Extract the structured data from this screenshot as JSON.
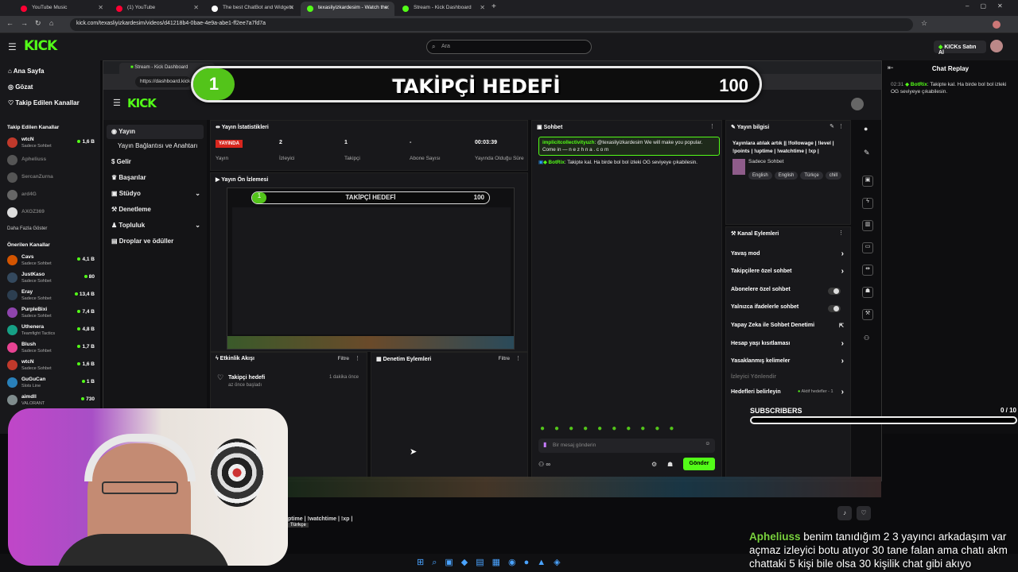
{
  "browser": {
    "tabs": [
      {
        "label": "YouTube Music",
        "color": "#ff0033"
      },
      {
        "label": "(1) YouTube",
        "color": "#ff0033"
      },
      {
        "label": "The best ChatBot and Widgets",
        "color": "#ffffff"
      },
      {
        "label": "texasliyizkardesim - Watch the",
        "color": "#53fc18"
      },
      {
        "label": "Stream - Kick Dashboard",
        "color": "#53fc18"
      }
    ],
    "url": "kick.com/texasliyizkardesim/videos/d41218b4-0bae-4e9a-abe1-ff2ee7a7fd7a"
  },
  "header": {
    "logo": "KICK",
    "search_placeholder": "Ara",
    "buy_kicks": "KICKs Satın Al"
  },
  "sidebar": {
    "nav": [
      "Ana Sayfa",
      "Gözat",
      "Takip Edilen Kanallar"
    ],
    "followed_title": "Takip Edilen Kanallar",
    "followed": [
      {
        "name": "wtcN",
        "category": "Sadece Sohbet",
        "viewers": "1,6 B",
        "online": true,
        "color": "#c0392b"
      },
      {
        "name": "Apheliuss",
        "category": "",
        "viewers": "",
        "online": false,
        "color": "#555"
      },
      {
        "name": "SercanZurna",
        "category": "",
        "viewers": "",
        "online": false,
        "color": "#555"
      },
      {
        "name": "ard4G",
        "category": "",
        "viewers": "",
        "online": false,
        "color": "#666"
      },
      {
        "name": "AXOZ369",
        "category": "",
        "viewers": "",
        "online": false,
        "color": "#ddd"
      }
    ],
    "show_more": "Daha Fazla Göster",
    "recommended_title": "Önerilen Kanallar",
    "recommended": [
      {
        "name": "Cavs",
        "category": "Sadece Sohbet",
        "viewers": "4,1 B",
        "color": "#d35400"
      },
      {
        "name": "JustKaso",
        "category": "Sadece Sohbet",
        "viewers": "80",
        "color": "#34495e"
      },
      {
        "name": "Eray",
        "category": "Sadece Sohbet",
        "viewers": "13,4 B",
        "color": "#2c3e50"
      },
      {
        "name": "PurpleBixi",
        "category": "Sadece Sohbet",
        "viewers": "7,4 B",
        "color": "#8e44ad"
      },
      {
        "name": "Uthenera",
        "category": "Teamfight Tactics",
        "viewers": "4,8 B",
        "color": "#16a085"
      },
      {
        "name": "Blush",
        "category": "Sadece Sohbet",
        "viewers": "1,7 B",
        "color": "#e84393"
      },
      {
        "name": "wtcN",
        "category": "Sadece Sohbet",
        "viewers": "1,6 B",
        "color": "#c0392b"
      },
      {
        "name": "GuGuCan",
        "category": "Slots Line",
        "viewers": "1 B",
        "color": "#2980b9"
      },
      {
        "name": "aimdll",
        "category": "VALORANT",
        "viewers": "730",
        "color": "#7f8c8d"
      }
    ]
  },
  "chat_replay": {
    "title": "Chat Replay",
    "messages": [
      {
        "time": "02:31",
        "user": "BotRix",
        "text": ": Takipte kal. Ha birde bol bol izleki OG seviyeye çıkabilesin."
      }
    ]
  },
  "inner": {
    "tab_label": "Stream - Kick Dashboard",
    "url": "https://dashboard.kick.com",
    "side_nav": [
      "Yayın",
      "Yayın Bağlantısı ve Anahtarı",
      "Gelir",
      "Başarılar",
      "Stüdyo",
      "Denetleme",
      "Topluluk",
      "Droplar ve ödüller"
    ],
    "stats_title": "Yayın İstatistikleri",
    "stats": [
      {
        "value": "YAYINDA",
        "label": "Yayın"
      },
      {
        "value": "2",
        "label": "İzleyici"
      },
      {
        "value": "1",
        "label": "Takipçi"
      },
      {
        "value": "-",
        "label": "Abone Sayısı"
      },
      {
        "value": "00:03:39",
        "label": "Yayında Olduğu Süre"
      }
    ],
    "preview_title": "Yayın Ön İzlemesi",
    "activity_title": "Etkinlik Akışı",
    "filter_label": "Filtre",
    "activity": {
      "title": "Takipçi hedefi",
      "subtitle": "az önce başladı",
      "time": "1 dakika önce"
    },
    "moderation_title": "Denetim Eylemleri",
    "chat_title": "Sohbet",
    "chat_messages": [
      {
        "user": "implicitcollectivityuzh",
        "text": ": @texasliyizkardesim We will make you popular. Come in — n e z h n a . c o m"
      },
      {
        "user": "BotRix",
        "text": ": Takipte kal. Ha birde bol bol izleki OG seviyeye çıkabilesin."
      }
    ],
    "chat_placeholder": "Bir mesaj gönderin",
    "send": "Gönder",
    "stream_info_title": "Yayın bilgisi",
    "stream_info_text": "Yayınlara atılak artık || !followage | !level | !points | !uptime | !watchtime | !xp |",
    "stream_category": "Sadece Sohbet",
    "stream_tags": [
      "English",
      "English",
      "Türkçe",
      "chill"
    ],
    "actions_title": "Kanal Eylemleri",
    "actions": [
      {
        "label": "Yavaş mod",
        "kind": "chevron"
      },
      {
        "label": "Takipçilere özel sohbet",
        "kind": "chevron"
      },
      {
        "label": "Abonelere özel sohbet",
        "kind": "toggle"
      },
      {
        "label": "Yalnızca ifadelerle sohbet",
        "kind": "toggle"
      },
      {
        "label": "Yapay Zeka ile Sohbet Denetimi",
        "kind": "link"
      },
      {
        "label": "Hesap yaşı kısıtlaması",
        "kind": "chevron"
      },
      {
        "label": "Yasaklanmış kelimeler",
        "kind": "chevron"
      },
      {
        "label": "İzleyici Yönlendir",
        "kind": "disabled"
      },
      {
        "label": "Hedefleri belirleyin",
        "kind": "goal",
        "extra": "Aktif hedefler - 1"
      }
    ]
  },
  "goal": {
    "current": "1",
    "title": "TAKİPÇİ HEDEFİ",
    "target": "100"
  },
  "subscribers": {
    "label": "SUBSCRIBERS",
    "count": "0 / 10",
    "progress": 0
  },
  "overlay_text": {
    "line1": "ptime | !watchtime | !xp |",
    "line2": "Türkçe"
  },
  "subtitle": {
    "name": "Apheliuss",
    "lines": [
      "benim tanıdığım 2 3 yayıncı arkadaşım var",
      "açmaz izleyici botu atıyor 30 tane falan ama chatı akm",
      "chattaki 5 kişi bile olsa 30 kişilik chat gibi akıyo"
    ]
  },
  "accent": "#53fc18"
}
